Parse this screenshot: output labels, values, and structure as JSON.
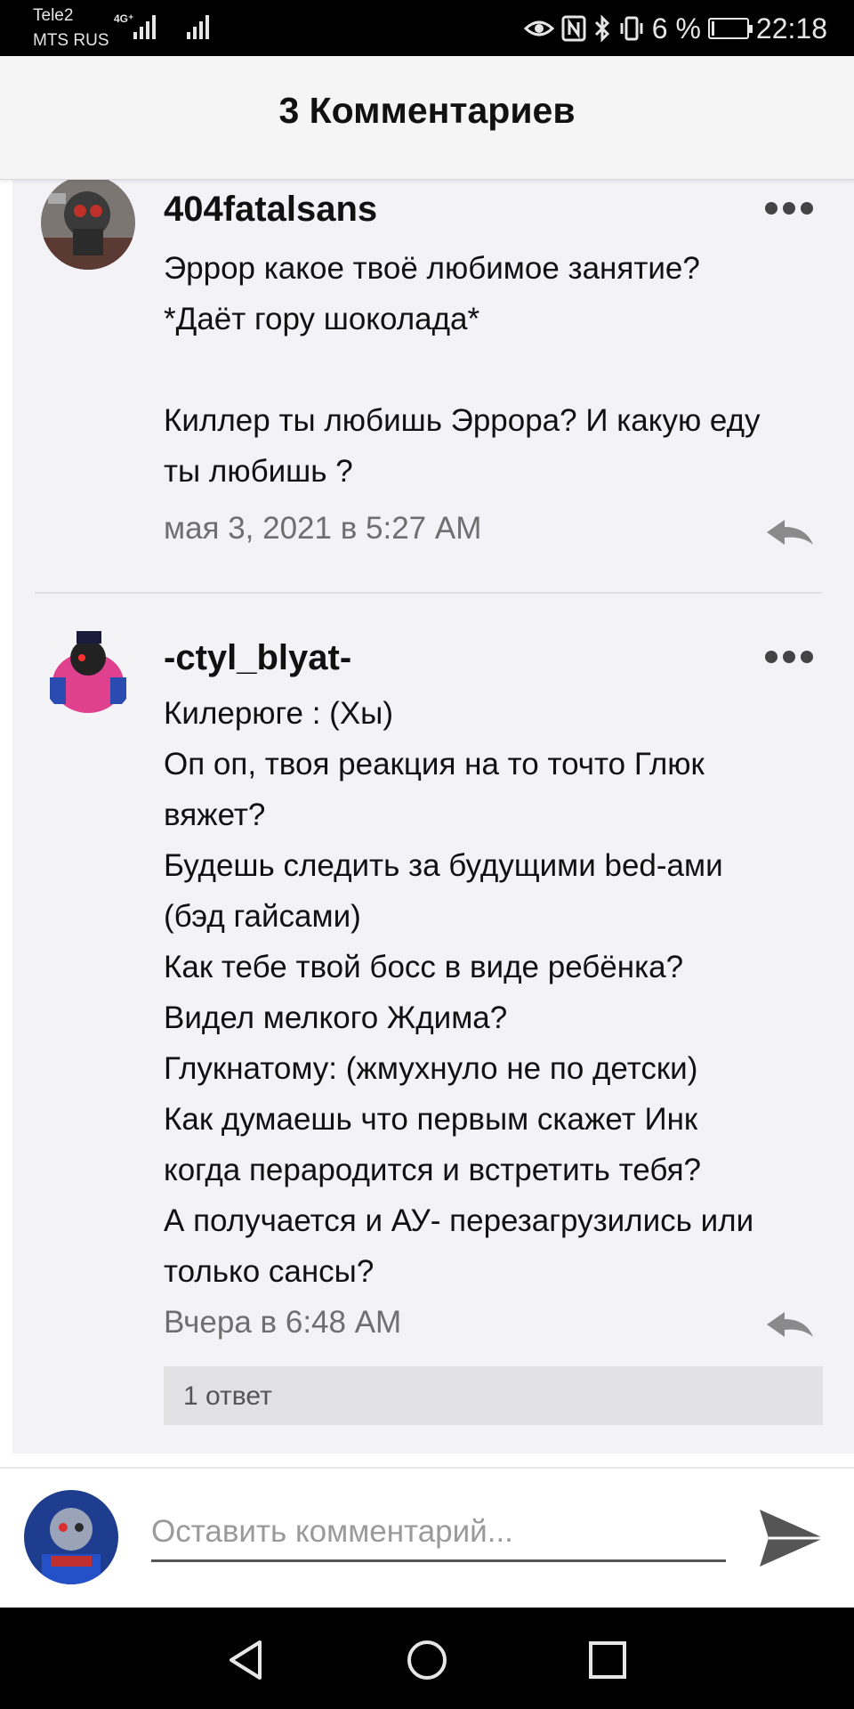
{
  "status_bar": {
    "carrier_1": "Tele2",
    "carrier_2": "MTS RUS",
    "network": "4G⁺",
    "icons": [
      "eye-icon",
      "nfc-icon",
      "bluetooth-icon",
      "vibrate-icon"
    ],
    "battery_percent": "6 %",
    "time": "22:18"
  },
  "header": {
    "title": "3 Комментариев"
  },
  "comments": [
    {
      "username": "404fatalsans",
      "text": "Эррор какое твоё любимое занятие?\n*Даёт гору шоколада*\n\nКиллер ты любишь Эррора? И какую еду\nты любишь ?",
      "timestamp": "мая 3, 2021 в 5:27 AM"
    },
    {
      "username": "-ctyl_blyat-",
      "text": "Килерюге : (Хы)\nОп оп, твоя реакция на то точто Глюк\nвяжет?\nБудешь следить за будущими bed-ами\n(бэд гайсами)\nКак тебе твой босс в виде ребёнка?\nВидел мелкого Ждима?\nГлукнатому: (жмухнуло не по детски)\nКак думаешь что первым скажет Инк\nкогда перародится и встретить тебя?\nА получается и АУ- перезагрузились или\nтолько сансы?",
      "timestamp": "Вчера в 6:48 AM",
      "replies_label": "1 ответ"
    }
  ],
  "composer": {
    "placeholder": "Оставить комментарий..."
  },
  "colors": {
    "accent": "#000000",
    "background": "#f3f2f7",
    "muted_text": "#6f6f6f"
  }
}
